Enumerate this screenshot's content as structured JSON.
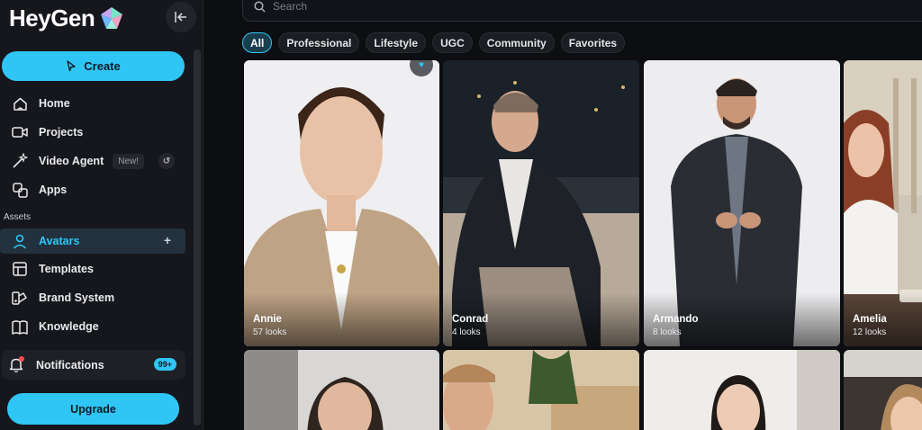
{
  "brand": {
    "name": "HeyGen"
  },
  "sidebar": {
    "create_label": "Create",
    "nav": [
      {
        "label": "Home",
        "icon": "home-icon"
      },
      {
        "label": "Projects",
        "icon": "video-camera-icon"
      },
      {
        "label": "Video Agent",
        "icon": "magic-wand-icon",
        "badge": "New!"
      },
      {
        "label": "Apps",
        "icon": "apps-icon"
      }
    ],
    "section_label": "Assets",
    "assets": [
      {
        "label": "Avatars",
        "icon": "person-icon",
        "active": true
      },
      {
        "label": "Templates",
        "icon": "template-icon"
      },
      {
        "label": "Brand System",
        "icon": "brand-icon"
      },
      {
        "label": "Knowledge",
        "icon": "knowledge-icon"
      }
    ],
    "notifications": {
      "label": "Notifications",
      "count": "99+"
    },
    "upgrade_label": "Upgrade"
  },
  "search": {
    "placeholder": "Search"
  },
  "filters": [
    "All",
    "Professional",
    "Lifestyle",
    "UGC",
    "Community",
    "Favorites"
  ],
  "active_filter": "All",
  "avatars": [
    {
      "name": "Annie",
      "looks": "57 looks"
    },
    {
      "name": "Conrad",
      "looks": "4 looks"
    },
    {
      "name": "Armando",
      "looks": "8 looks"
    },
    {
      "name": "Amelia",
      "looks": "12 looks"
    }
  ],
  "colors": {
    "accent": "#2fc6f6",
    "sidebar_bg": "#16171c",
    "page_bg": "#0d0e12"
  }
}
